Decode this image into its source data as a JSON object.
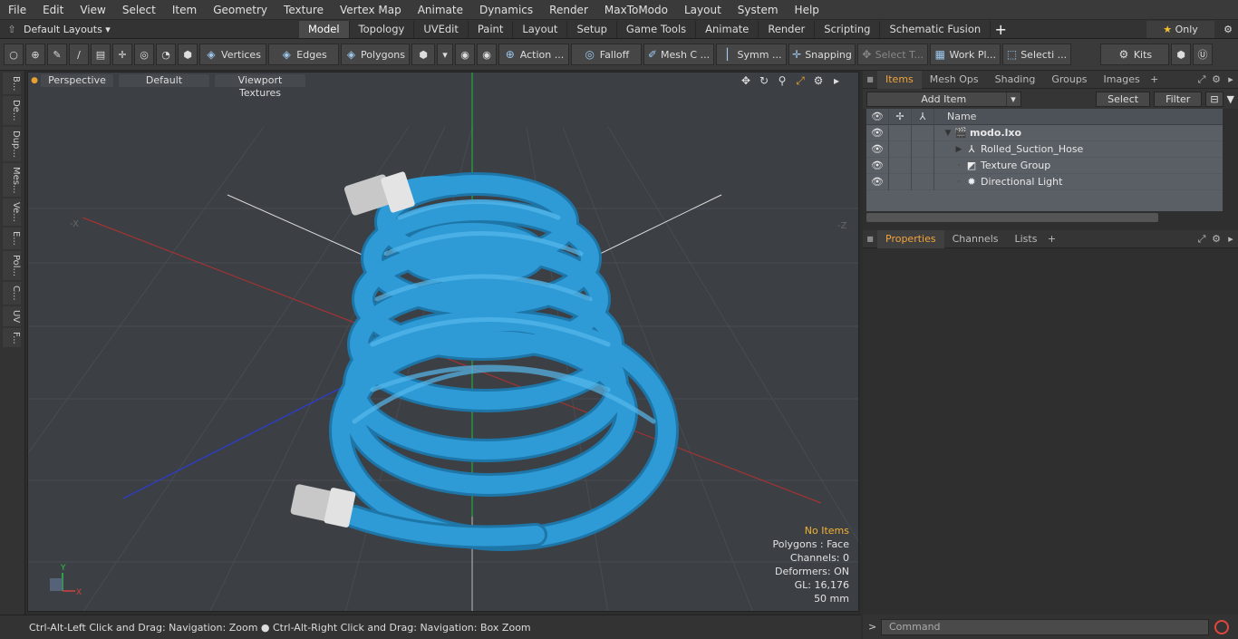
{
  "menu": [
    "File",
    "Edit",
    "View",
    "Select",
    "Item",
    "Geometry",
    "Texture",
    "Vertex Map",
    "Animate",
    "Dynamics",
    "Render",
    "MaxToModo",
    "Layout",
    "System",
    "Help"
  ],
  "layouts": {
    "label": "Default Layouts ▾"
  },
  "tabs": [
    "Model",
    "Topology",
    "UVEdit",
    "Paint",
    "Layout",
    "Setup",
    "Game Tools",
    "Animate",
    "Render",
    "Scripting",
    "Schematic Fusion"
  ],
  "tabs_active": "Model",
  "only_label": "Only",
  "toolbar": {
    "vertices": "Vertices",
    "edges": "Edges",
    "polygons": "Polygons",
    "action": "Action ...",
    "falloff": "Falloff",
    "meshc": "Mesh C ...",
    "symm": "Symm ...",
    "snapping": "Snapping",
    "selectt": "Select T...",
    "workpl": "Work Pl...",
    "selecti": "Selecti ...",
    "kits": "Kits"
  },
  "left_tabs": [
    "B...",
    "De...",
    "Dup...",
    "Mes...",
    "Ve...",
    "E...",
    "Pol...",
    "C...",
    "UV",
    "F..."
  ],
  "viewport": {
    "view": "Perspective",
    "shading": "Default",
    "textures": "Viewport Textures",
    "stats": {
      "items": "No Items",
      "polygons": "Polygons : Face",
      "channels": "Channels: 0",
      "deformers": "Deformers: ON",
      "gl": "GL: 16,176",
      "size": "50 mm"
    }
  },
  "status": "Ctrl-Alt-Left Click and Drag: Navigation: Zoom ● Ctrl-Alt-Right Click and Drag: Navigation: Box Zoom",
  "panel": {
    "tabs": [
      "Items",
      "Mesh Ops",
      "Shading",
      "Groups",
      "Images"
    ],
    "add_item": "Add Item",
    "select": "Select",
    "filter": "Filter",
    "name_header": "Name",
    "items": [
      {
        "name": "modo.lxo",
        "bold": true,
        "indent": 0,
        "icon": "scene-icon"
      },
      {
        "name": "Rolled_Suction_Hose",
        "bold": false,
        "indent": 1,
        "icon": "mesh-icon"
      },
      {
        "name": "Texture Group",
        "bold": false,
        "indent": 1,
        "icon": "texture-group-icon"
      },
      {
        "name": "Directional Light",
        "bold": false,
        "indent": 1,
        "icon": "light-icon"
      }
    ],
    "prop_tabs": [
      "Properties",
      "Channels",
      "Lists"
    ],
    "command_placeholder": "Command"
  },
  "colors": {
    "hose": "#2e9bd6",
    "accent": "#f0a43a"
  }
}
